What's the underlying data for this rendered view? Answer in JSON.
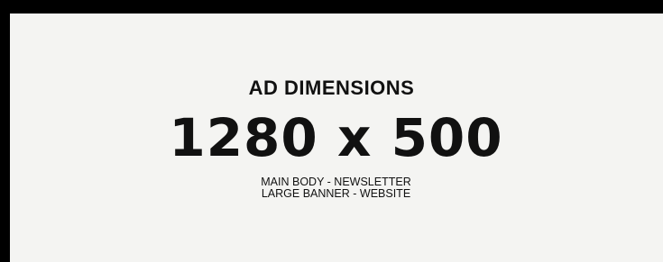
{
  "ad": {
    "heading": "AD DIMENSIONS",
    "size": "1280 x 500",
    "placements": [
      "MAIN BODY - NEWSLETTER",
      "LARGE BANNER - WEBSITE"
    ]
  },
  "colors": {
    "border": "#000000",
    "background": "#f4f4f2",
    "text": "#111111"
  }
}
